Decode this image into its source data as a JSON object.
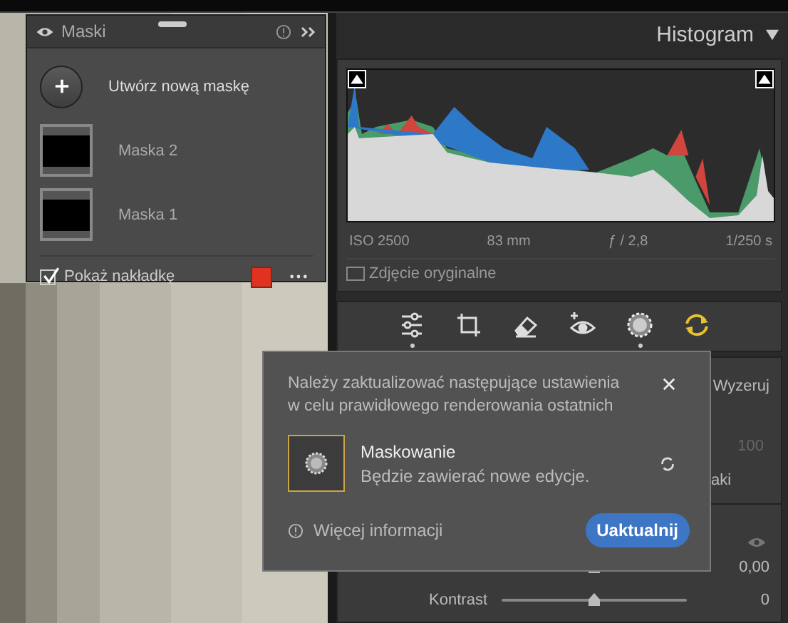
{
  "masks_panel": {
    "title": "Maski",
    "create_label": "Utwórz nową maskę",
    "masks": [
      {
        "name": "Maska 2",
        "selected": false
      },
      {
        "name": "Maska 1",
        "selected": false
      }
    ],
    "show_overlay": {
      "label": "Pokaż nakładkę",
      "checked": true,
      "color": "#e0321e"
    }
  },
  "histogram": {
    "title": "Histogram",
    "expanded": true,
    "info": [
      "ISO 2500",
      "83 mm",
      "ƒ / 2,8",
      "1/250 s"
    ],
    "original_photo": {
      "label": "Zdjęcie oryginalne",
      "checked": false
    }
  },
  "tools": [
    {
      "kind": "edit",
      "selected": true
    },
    {
      "kind": "crop",
      "selected": false
    },
    {
      "kind": "heal",
      "selected": false
    },
    {
      "kind": "redeye",
      "selected": false
    },
    {
      "kind": "masking",
      "selected": true
    },
    {
      "kind": "update",
      "selected": false
    }
  ],
  "edit_panel": {
    "reset": "Wyzeruj",
    "amount": "100",
    "note": "aki",
    "sliders": [
      {
        "value": "0,00",
        "level": 0.5
      },
      {
        "label": "Kontrast",
        "value": "0",
        "level": 0.5
      }
    ]
  },
  "update_dialog": {
    "message": "Należy zaktualizować następujące ustawienia w celu prawidłowego renderowania ostatnich",
    "item": {
      "title": "Maskowanie",
      "description": "Będzie zawierać nowe edycje."
    },
    "more_info": "Więcej informacji",
    "update_button": "Uaktualnij"
  }
}
